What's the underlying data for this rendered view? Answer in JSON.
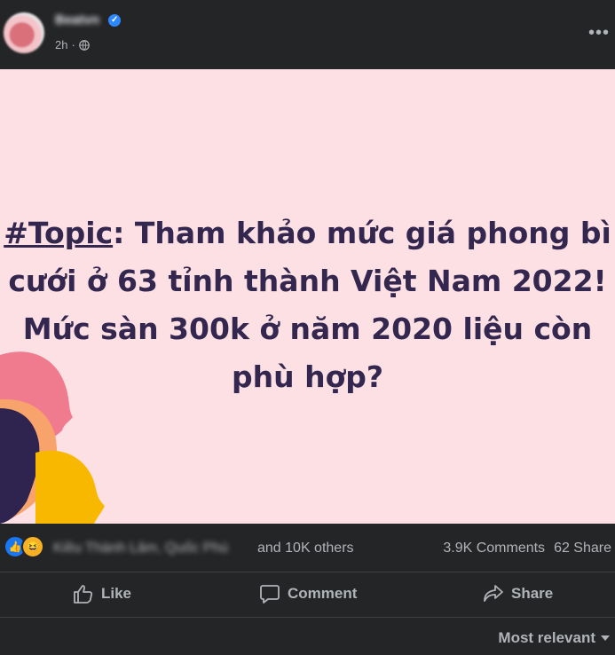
{
  "post": {
    "author_name": "Beatvn",
    "time": "2h",
    "visibility_icon": "globe-icon",
    "more_icon": "more-icon"
  },
  "image": {
    "topic_tag": "#Topic",
    "headline_part1": ": Tham khảo mức giá phong bì",
    "headline_line2": "cưới ở 63 tỉnh thành Việt Nam 2022!",
    "headline_line3": "Mức sàn 300k ở năm 2020 liệu còn",
    "headline_line4": "phù hợp?",
    "background_color": "#fde0e4",
    "text_color": "#33274f"
  },
  "stats": {
    "reaction_icons": [
      "like-icon",
      "haha-icon"
    ],
    "reactor_names": "Kiều Thành Lâm, Quốc Phú",
    "others_text": "and 10K others",
    "comments_text": "3.9K Comments",
    "shares_text": "62 Share"
  },
  "actions": {
    "like_label": "Like",
    "comment_label": "Comment",
    "share_label": "Share"
  },
  "comments": {
    "sort_label": "Most relevant"
  }
}
